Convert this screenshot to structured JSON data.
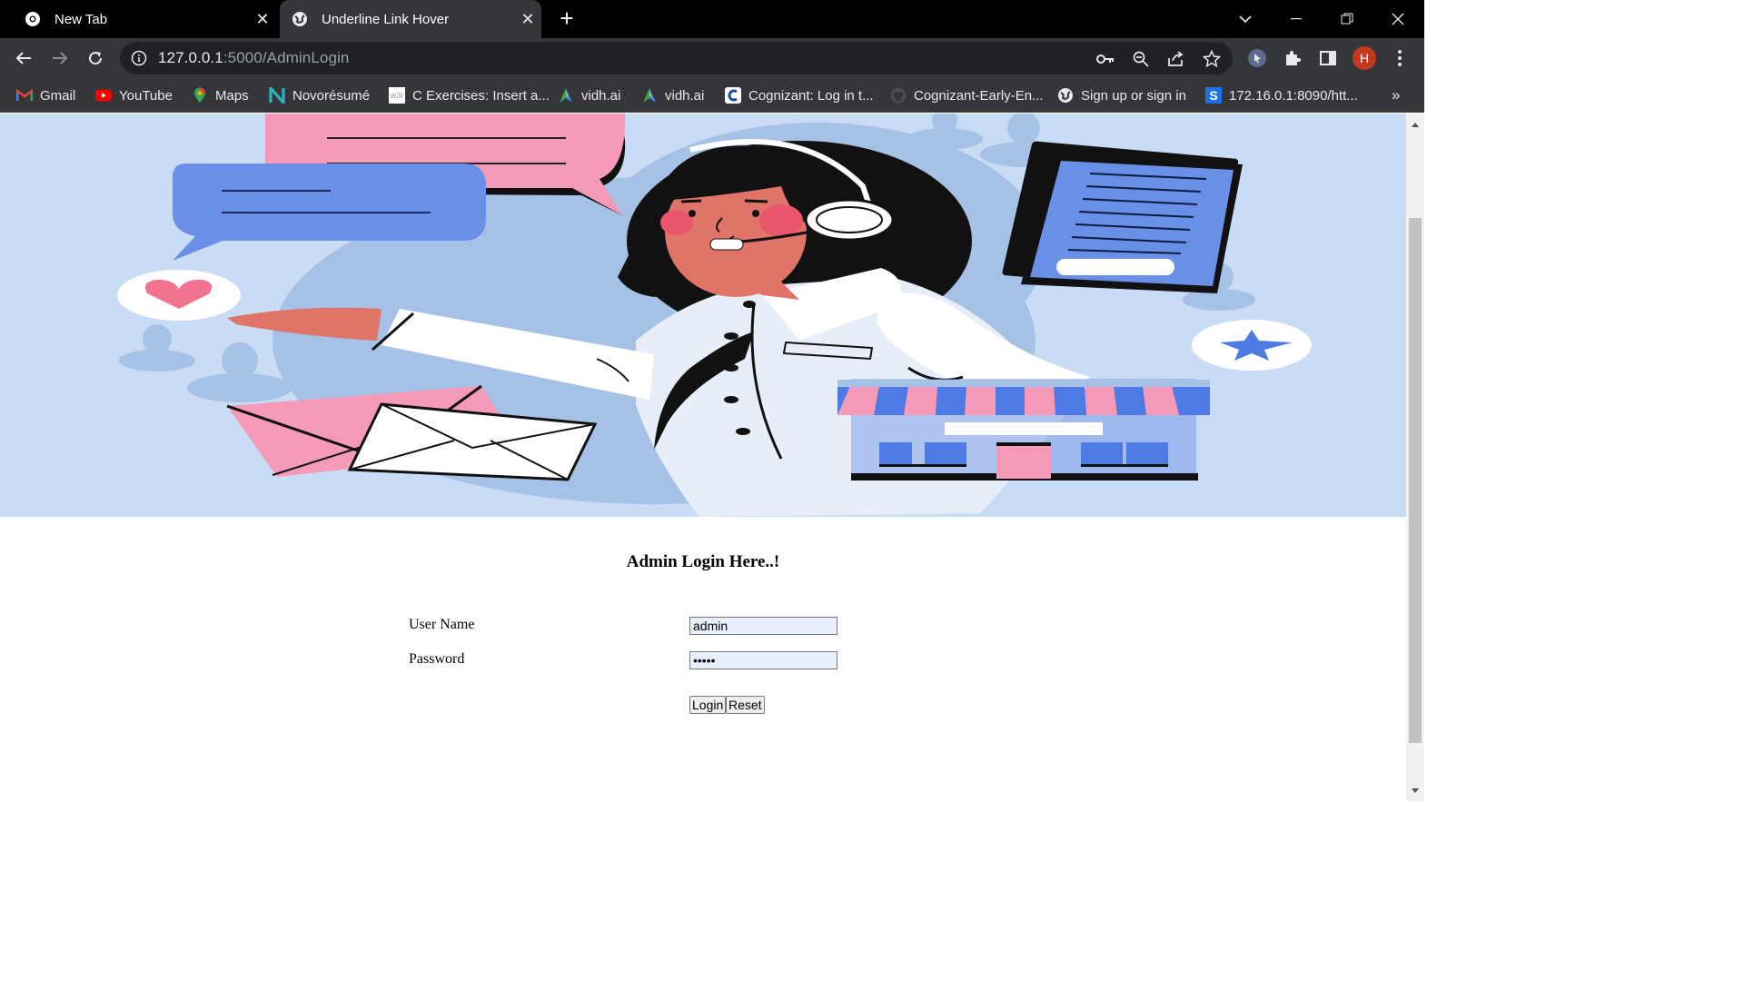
{
  "browser": {
    "tabs": [
      {
        "title": "New Tab",
        "active": false
      },
      {
        "title": "Underline Link Hover",
        "active": true
      }
    ],
    "new_tab_symbol": "+",
    "close_symbol": "✕",
    "url_host": "127.0.0.1",
    "url_rest": ":5000/AdminLogin",
    "profile_initial": "H",
    "bookmarks": [
      {
        "label": "Gmail",
        "icon": "gmail-icon"
      },
      {
        "label": "YouTube",
        "icon": "youtube-icon"
      },
      {
        "label": "Maps",
        "icon": "maps-icon"
      },
      {
        "label": "Novorésumé",
        "icon": "novoresume-icon"
      },
      {
        "label": "C Exercises: Insert a...",
        "icon": "w3r-icon"
      },
      {
        "label": "vidh.ai",
        "icon": "vidh-icon"
      },
      {
        "label": "vidh.ai",
        "icon": "vidh-icon"
      },
      {
        "label": "Cognizant: Log in t...",
        "icon": "cognizant-icon"
      },
      {
        "label": "Cognizant-Early-En...",
        "icon": "github-icon"
      },
      {
        "label": "Sign up or sign in",
        "icon": "globe-icon"
      },
      {
        "label": "172.16.0.1:8090/htt...",
        "icon": "sophos-icon"
      }
    ],
    "bookmarks_overflow": "»",
    "w3r_text": "w3r",
    "sophos_text": "S"
  },
  "page": {
    "heading": "Admin Login Here..!",
    "username_label": "User Name",
    "password_label": "Password",
    "username_value": "admin",
    "password_value": "•••••",
    "login_button": "Login",
    "reset_button": "Reset"
  },
  "colors": {
    "hero_bg": "#c9dcf5",
    "pink": "#f59ab8",
    "blue": "#6a8fe6",
    "chrome_dark": "#35363a",
    "profile_red": "#c5391e"
  }
}
